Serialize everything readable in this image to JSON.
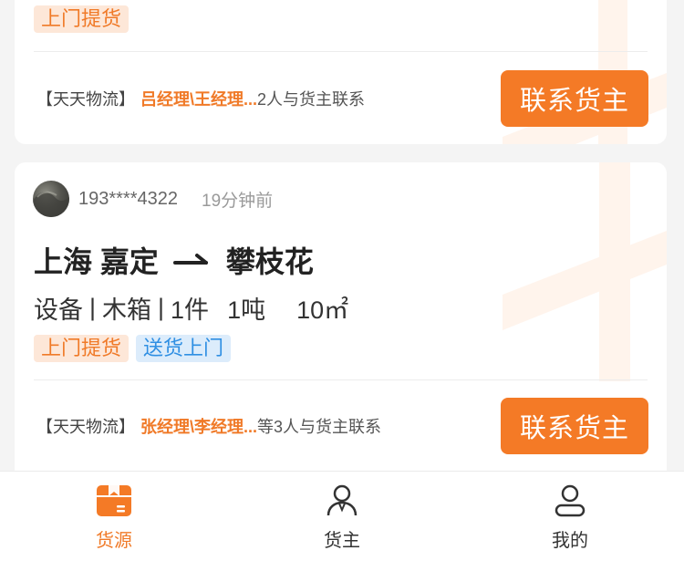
{
  "cards": [
    {
      "tags": [
        {
          "label": "上门提货",
          "style": "pickup"
        }
      ],
      "contact": {
        "company": "【天天物流】",
        "managers": "吕经理\\王经理...",
        "suffix": "2人与货主联系"
      },
      "button_label": "联系货主"
    },
    {
      "user": {
        "phone": "193****4322",
        "time_ago": "19分钟前"
      },
      "route": {
        "origin": "上海 嘉定",
        "destination": "攀枝花"
      },
      "cargo": {
        "category": "设备",
        "package": "木箱",
        "count": "1件",
        "weight": "1吨",
        "volume": "10㎡"
      },
      "tags": [
        {
          "label": "上门提货",
          "style": "pickup"
        },
        {
          "label": "送货上门",
          "style": "delivery"
        }
      ],
      "contact": {
        "company": "【天天物流】",
        "managers": "张经理\\李经理...",
        "suffix": "等3人与货主联系"
      },
      "button_label": "联系货主"
    }
  ],
  "tabbar": {
    "items": [
      {
        "label": "货源",
        "icon": "cargo-box-icon",
        "active": true
      },
      {
        "label": "货主",
        "icon": "shipper-person-icon",
        "active": false
      },
      {
        "label": "我的",
        "icon": "profile-icon",
        "active": false
      }
    ]
  },
  "colors": {
    "accent": "#f47a26",
    "pickup_tag_bg": "#fde7d8",
    "delivery_tag_bg": "#dcecfb",
    "delivery_tag_text": "#2f8fe3"
  }
}
